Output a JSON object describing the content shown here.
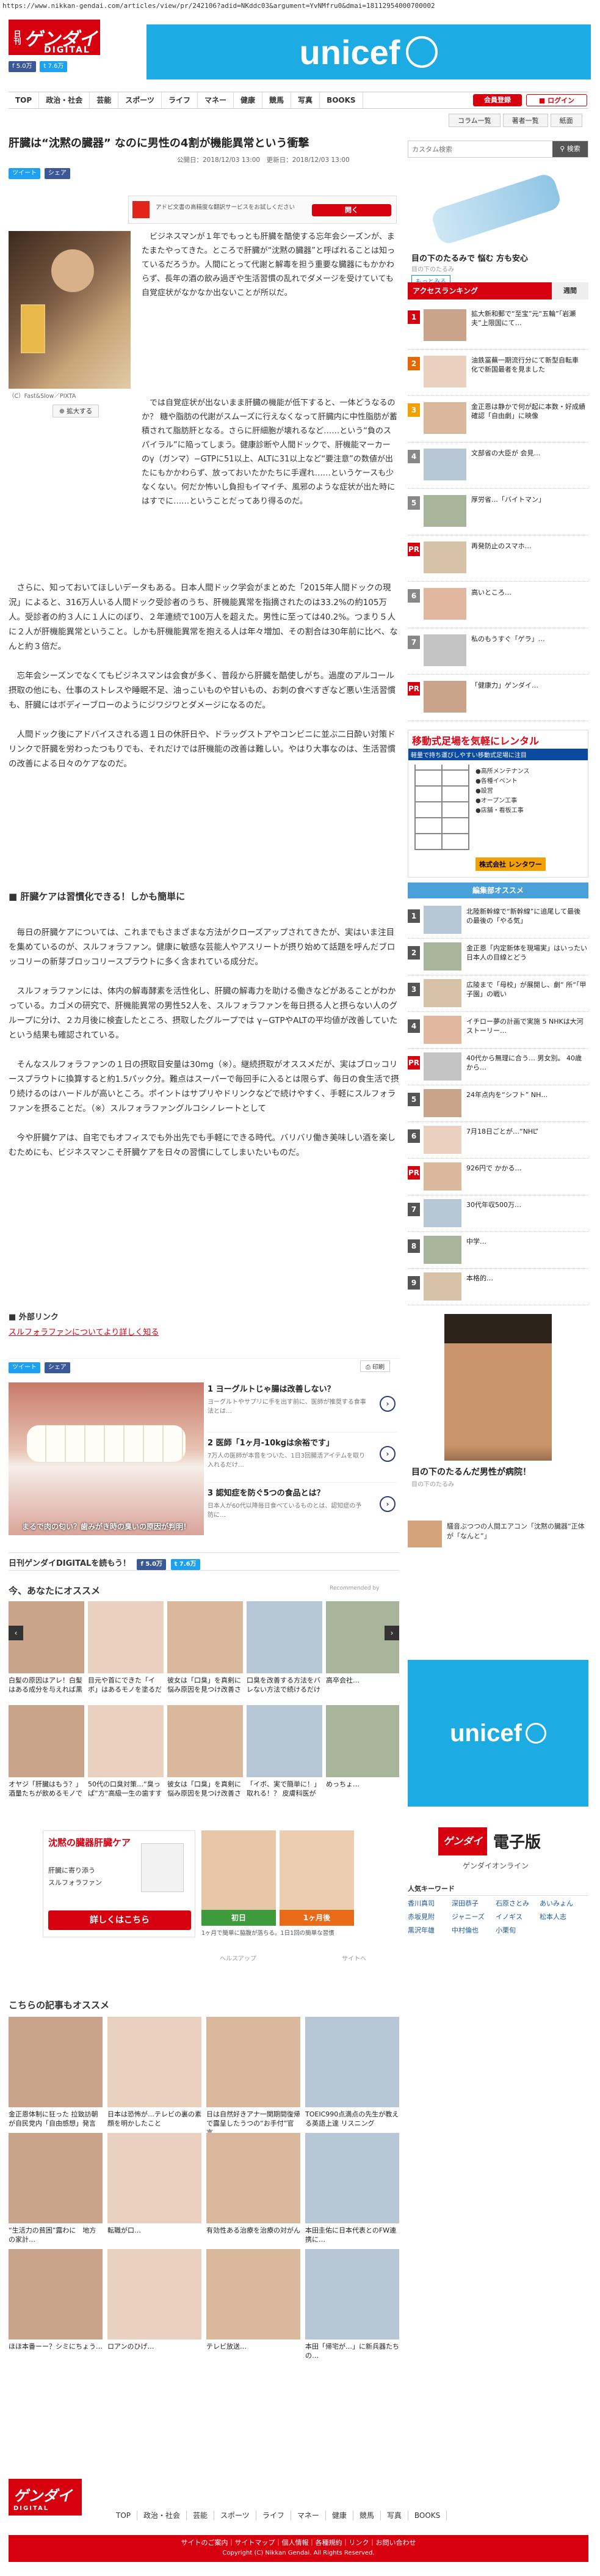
{
  "browser": {
    "url": "https://www.nikkan-gendai.com/articles/view/pr/242106?adid=NKddc03&argument=YvNMfru0&dmai=18112954000700002"
  },
  "header": {
    "logo_top": "日刊",
    "logo_main": "ゲンダイ",
    "logo_sub": "DIGITAL",
    "fb_like": "5.0万",
    "tw_follow": "7.6万",
    "unicef": "unicef"
  },
  "nav": [
    "TOP",
    "政治・社会",
    "芸能",
    "スポーツ",
    "ライフ",
    "マネー",
    "健康",
    "競馬",
    "写真",
    "BOOKS"
  ],
  "nav_buttons": {
    "member": "会員登録",
    "login": "ログイン"
  },
  "subnav": [
    "コラム一覧",
    "著者一覧",
    "紙面"
  ],
  "article": {
    "title": "肝臓は“沈黙の臓器” なのに男性の4割が機能異常という衝撃",
    "date": "公開日：2018/12/03 13:00　更新日：2018/12/03 13:00",
    "tweet": "ツイート",
    "share": "シェア",
    "ad_text": "アドビ文書の高精度な翻訳サービスをお試しください",
    "ad_btn": "開く",
    "photo_caption": "（C）Fast&Slow／PIXTA",
    "zoom": "拡大する",
    "p1": "ビジネスマンが１年でもっとも肝臓を酷使する忘年会シーズンが、またまたやってきた。ところで肝臓が“沈黙の臓器”と呼ばれることは知っているだろうか。人間にとって代謝と解毒を担う重要な臓器にもかかわらず、長年の酒の飲み過ぎや生活習慣の乱れでダメージを受けていても自覚症状がなかなか出ないことが所以だ。",
    "p2": "では自覚症状が出ないまま肝臓の機能が低下すると、一体どうなるのか？ 糖や脂肪の代謝がスムーズに行えなくなって肝臓内に中性脂肪が蓄積されて脂肪肝となる。さらに肝細胞が壊れるなど……という“負のスパイラル”に陥ってしまう。健康診断や人間ドックで、肝機能マーカーのγ（ガンマ）−GTPに51以上、ALTに31以上など“要注意”の数値が出たにもかかわらず、放っておいたかたちに手遅れ……というケースも少なくない。何だか怖いし負担もイマイチ、風邪のような症状が出た時にはすでに……ということだってあり得るのだ。",
    "p3": "さらに、知っておいてほしいデータもある。日本人間ドック学会がまとめた「2015年人間ドックの現況」によると、316万人いる人間ドック受診者のうち、肝機能異常を指摘されたのは33.2%の約105万人。受診者の約３人に１人にのぼり、２年連続で100万人を超えた。男性に至っては40.2%。つまり５人に２人が肝機能異常ということ。しかも肝機能異常を抱える人は年々増加、その割合は30年前に比べ、なんと約３倍だ。",
    "p4": "忘年会シーズンでなくてもビジネスマンは会食が多く、普段から肝臓を酷使しがち。過度のアルコール摂取の他にも、仕事のストレスや睡眠不足、油っこいものや甘いもの、お刺の食べすぎなど悪い生活習慣も、肝臓にはボディーブローのようにジワジワとダメージになるのだ。",
    "p5": "人間ドック後にアドバイスされる週１日の休肝日や、ドラッグストアやコンビニに並ぶ二日酔い対策ドリンクで肝臓を労わったつもりでも、それだけでは肝機能の改善は難しい。やはり大事なのは、生活習慣の改善による日々のケアなのだ。",
    "h2": "肝臓ケアは習慣化できる！しかも簡単に",
    "p6": "毎日の肝臓ケアについては、これまでもさまざまな方法がクローズアップされてきたが、実はいま注目を集めているのが、スルフォラファン。健康に敏感な芸能人やアスリートが摂り始めて話題を呼んだブロッコリーの新芽ブロッコリースプラウトに多く含まれている成分だ。",
    "p7": "スルフォラファンには、体内の解毒酵素を活性化し、肝臓の解毒力を助ける働きなどがあることがわかっている。カゴメの研究で、肝機能異常の男性52人を、スルフォラファンを毎日摂る人と摂らない人のグループに分け、２カ月後に検査したところ、摂取したグループでは γ−GTPやALTの平均値が改善していたという結果も確認されている。",
    "p8": "そんなスルフォラファンの１日の摂取目安量は30mg（※）。継続摂取がオススメだが、実はブロッコリースプラウトに換算すると約1.5パック分。難点はスーパーで毎回手に入るとは限らず、毎日の食生活で摂り続けるのはハードルが高いところ。ポイントはサプリやドリンクなどで続けやすく、手軽にスルフォラファンを摂ることだ。（※）スルフォラファングルコシノレートとして",
    "p9": "今や肝臓ケアは、自宅でもオフィスでも外出先でも手軽にできる時代。バリバリ働き美味しい酒を楽しむためにも、ビジネスマンこそ肝臓ケアを日々の習慣にしてしまいたいものだ。",
    "ext_link_head": "外部リンク",
    "ext_link": "スルフォラファンについてより詳しく知る",
    "print": "印刷"
  },
  "ad_dental": {
    "caption": "まるで肉の匂い？歯みがき時の臭いの原因が判明！",
    "items": [
      {
        "num": "1",
        "title": "ヨーグルトじゃ腸は改善しない？",
        "desc": "ヨーグルトやサプリに手を出す前に、医師が推奨する食事法とは…"
      },
      {
        "num": "2",
        "title": "医師「1ヶ月-10kgは余裕です」",
        "desc": "7万人の医師が本音をついた、1日3回腸活アイテムを取り入れるだけ…"
      },
      {
        "num": "3",
        "title": "認知症を防ぐ5つの食品とは？",
        "desc": "日本人が60代以降毎日食べているものとは、認知症の予防に…"
      }
    ]
  },
  "read_bar": {
    "text": "日刊ゲンダイDIGITALを読もう！",
    "fb": "5.0万",
    "tw": "7.6万"
  },
  "recommend": {
    "head": "今、あなたにオススメ",
    "credit": "Recommended by",
    "row1": [
      {
        "t": "白髪の原因はアレ！白髪はある成分を与えれば黒に戻る人も！？",
        "s": "AD（ふくたんの話）"
      },
      {
        "t": "目元や首にできた「イボ」はあるモノを塗るだけで簡単に落ちる！？",
        "s": "AD（ガーデン）"
      },
      {
        "t": "彼女は「口臭」を真剣に悩み原因を見つけ改善させた方法",
        "s": "AD（ロイズ）"
      },
      {
        "t": "口臭を改善する方法をバレない方法で続けるだけ",
        "s": "AD"
      },
      {
        "t": "高卒会社…",
        "s": "AD"
      }
    ],
    "row2": [
      {
        "t": "オヤジ「肝臓はもう？」酒量たちが飲めるモノで肝臓ケア",
        "s": "AD（スルフォラファン）"
      },
      {
        "t": "50代の口臭対策…“臭っぱ”方“高級一生の歯すすぎ”に…",
        "s": "AD（ロイズ）"
      },
      {
        "t": "彼女は「口臭」を真剣に悩み原因を見つけ改善させた方法",
        "s": "AD（nanacoto）"
      },
      {
        "t": "「イボ、実で簡単に！」取れる！？ 皮膚科医がネタ！主婦の…",
        "s": "AD（beauty apps）"
      },
      {
        "t": "めっちょ…",
        "s": "AD"
      }
    ]
  },
  "promo": {
    "ad_title": "沈黙の臓器肝臓ケア",
    "ad_sub": "肝臓に寄り添う",
    "brand": "スルフォラファン",
    "more": "詳しくはこちら",
    "before": "初日",
    "after": "1ヶ月後",
    "caption": "1ヶ月で簡単に脇腹が落ちる。1日1回の簡単な習慣",
    "help": "ヘルスアップ",
    "site": "サイトへ"
  },
  "second_rec": {
    "head": "こちらの記事もオススメ",
    "row1": [
      {
        "t": "金正恩体制に狂った 拉致訪朝が自民党内「自由感想」発言",
        "s": ""
      },
      {
        "t": "日本は恐怖が…テレビの裏の素顔を明かしたこと",
        "s": ""
      },
      {
        "t": "日は自然好きアナ一関期間復帰で露呈したうつの“お手付”官言",
        "s": ""
      },
      {
        "t": "TOEIC990点満点の先生が教える英語上達 リスニング",
        "s": "AD（Infinit Summer）"
      }
    ],
    "row2": [
      {
        "t": "“生活力の貧困”露わに　地方の家計…",
        "s": ""
      },
      {
        "t": "転職が口…",
        "s": ""
      },
      {
        "t": "有効性ある治療を治療の対がん",
        "s": ""
      },
      {
        "t": "本田圭佑に日本代表とのFW連携に…",
        "s": ""
      }
    ],
    "row3": [
      {
        "t": "ほほ本番ーー？シミにちょう…",
        "s": ""
      },
      {
        "t": "ロアンのひげ…",
        "s": ""
      },
      {
        "t": "テレビ放送…",
        "s": ""
      },
      {
        "t": "本田「帰宅が…」に新兵器たちの…",
        "s": ""
      }
    ]
  },
  "sidebar": {
    "search_placeholder": "カスタム検索",
    "search_btn": "検索",
    "ad_caption": "目の下のたるみで 悩む 方も安心",
    "ad_sub": "目の下のたるみ",
    "ad_btn": "もっとみる",
    "tabs": [
      "アクセスランキング",
      "週間"
    ],
    "ranking": [
      {
        "num": "1",
        "t": "拡大新和郵で“至宝”元“五輪”「岩瀬夫”上限国にて…",
        "color": "#d7000f"
      },
      {
        "num": "2",
        "t": "油鉄冨蕪一期流行分にて新型自転車 化で新国最者を見ました",
        "color": "#e66600"
      },
      {
        "num": "3",
        "t": "金正恩は静かで何が起に本数・好成績確認「自由劇」に映像",
        "color": "#f2a100"
      },
      {
        "num": "4",
        "t": "文部省の大臣が 会見…",
        "color": "#888"
      },
      {
        "num": "5",
        "t": "厚労省…「バイトマン」",
        "color": "#888"
      },
      {
        "num": "PR",
        "t": "再発防止のスマホ…",
        "color": "#d7000f"
      },
      {
        "num": "6",
        "t": "高いところ…",
        "color": "#888"
      },
      {
        "num": "7",
        "t": "私のもうすぐ「ゲラ」…",
        "color": "#888"
      },
      {
        "num": "PR",
        "t": "「健康力」ゲンダイ…",
        "color": "#d7000f"
      }
    ],
    "banner_title": "移動式足場を気軽にレンタル",
    "banner_sub": "軽量で持ち運びしやすい移動式足場に注目",
    "banner_list": [
      "●高所メンテナンス",
      "●各種イベント",
      "●設営",
      "●オープン工事",
      "●店舗・看板工事"
    ],
    "banner_company": "株式会社 レンタワー",
    "editors_head": "編集部オススメ",
    "editors": [
      {
        "num": "1",
        "t": "北陸新幹線で“新幹線”に追尾して最後の最後の「やる気」"
      },
      {
        "num": "2",
        "t": "金正恩「内定新体を現場実」はいったい 日本人の目線とどう"
      },
      {
        "num": "3",
        "t": "広陵まで「母校」が展開し、劇“ 所“「甲子園」の戦い"
      },
      {
        "num": "4",
        "t": "イチロー夢の計画で実施 5 NHKは大河ストーリー…"
      },
      {
        "num": "PR",
        "t": "40代から無理に合う… 男女別。 40歳から…"
      },
      {
        "num": "5",
        "t": "24年点内を“シフト” NH…"
      },
      {
        "num": "6",
        "t": "7月18日ごとが…“NHL”"
      },
      {
        "num": "PR",
        "t": "926円で かかる…"
      },
      {
        "num": "7",
        "t": "30代年収500万…"
      },
      {
        "num": "8",
        "t": "中学…"
      },
      {
        "num": "9",
        "t": "本格的…"
      }
    ],
    "face_caption": "目の下のたるんだ男性が病院！",
    "face_sub": "目の下のたるみ",
    "small_ad": "騒音ぶつつの人間エアコン「沈黙の臓器“正体が「なんと”」",
    "digital": "電子版",
    "digital_sub": "ゲンダイオンライン",
    "people_head": "人気キーワード",
    "people": [
      "香川真司",
      "深田恭子",
      "石原さとみ",
      "あいみょん",
      "赤坂見附",
      "ジャニーズ",
      "イノギス",
      "松本人志",
      "黒沢年雄",
      "中村倫也",
      "小栗旬"
    ]
  },
  "footer": {
    "nav": [
      "TOP",
      "政治・社会",
      "芸能",
      "スポーツ",
      "ライフ",
      "マネー",
      "健康",
      "競馬",
      "写真",
      "BOOKS"
    ],
    "links": "サイトのご案内｜サイトマップ｜個人情報｜各種規約｜リンク｜お問い合わせ",
    "copyright": "Copyright (C) Nikkan Gendai. All Rights Reserved."
  }
}
